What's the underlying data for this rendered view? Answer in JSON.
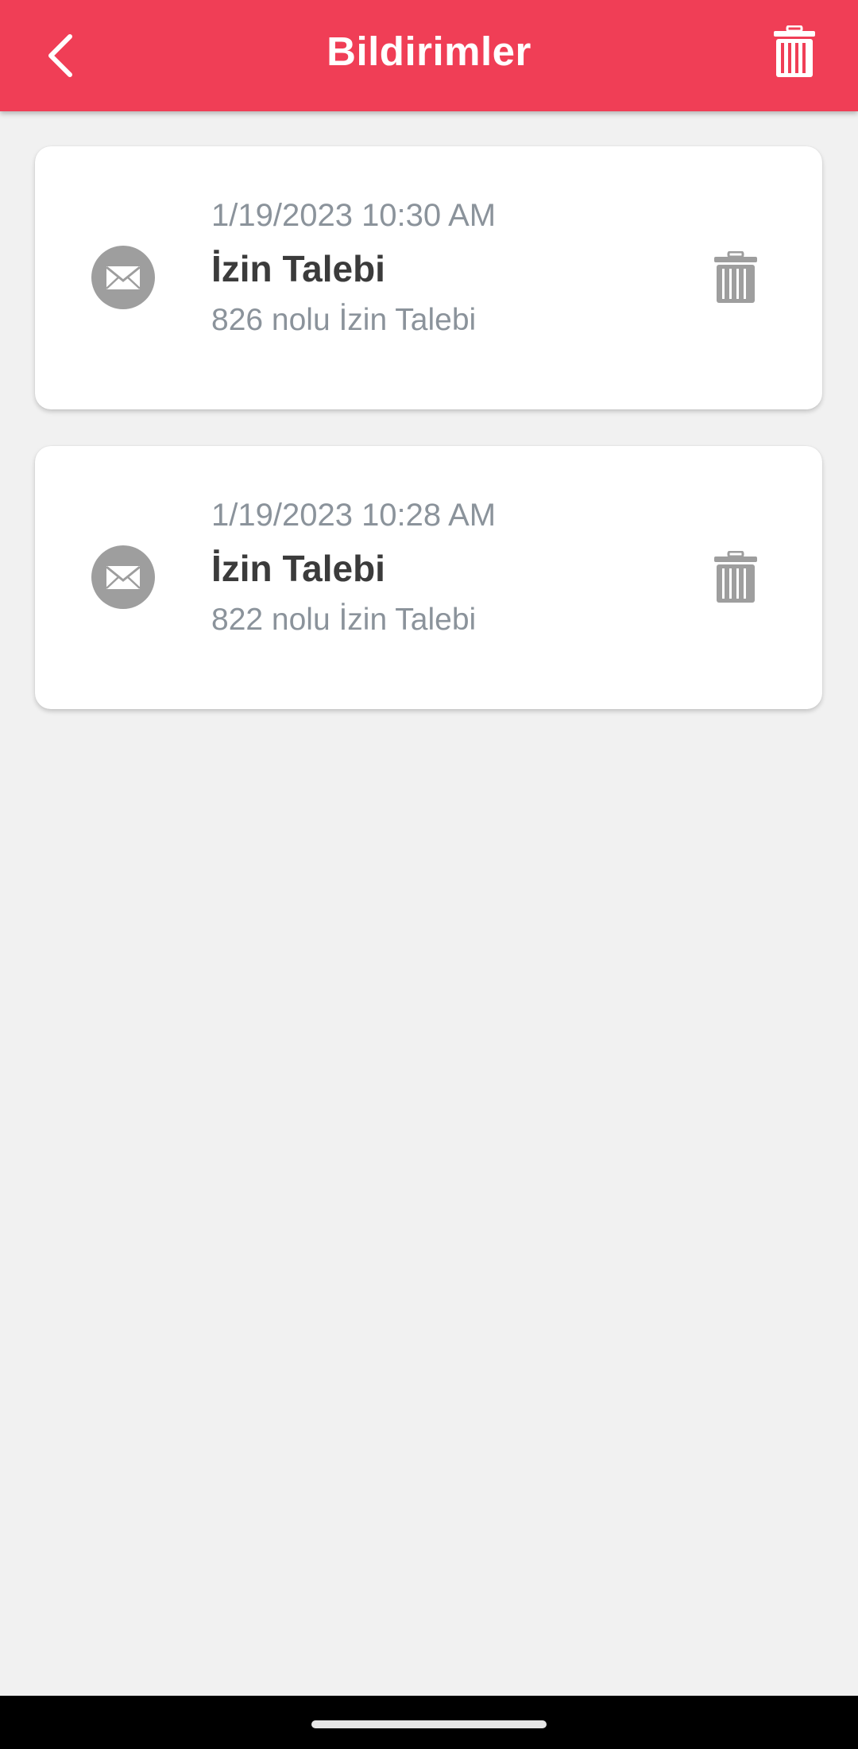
{
  "app_bar": {
    "title": "Bildirimler",
    "back_icon": "chevron-left-icon",
    "clear_all_icon": "trash-icon",
    "background_color": "#f03e56"
  },
  "notifications": [
    {
      "icon": "mail-icon",
      "timestamp": "1/19/2023 10:30 AM",
      "title": "İzin Talebi",
      "body": "826 nolu İzin Talebi",
      "delete_icon": "trash-icon"
    },
    {
      "icon": "mail-icon",
      "timestamp": "1/19/2023 10:28 AM",
      "title": "İzin Talebi",
      "body": "822 nolu İzin Talebi",
      "delete_icon": "trash-icon"
    }
  ],
  "colors": {
    "accent": "#f03e56",
    "icon_gray": "#9e9e9e",
    "secondary_text": "#8b939b",
    "primary_text": "#3b3b3b",
    "background": "#f1f1f1"
  }
}
